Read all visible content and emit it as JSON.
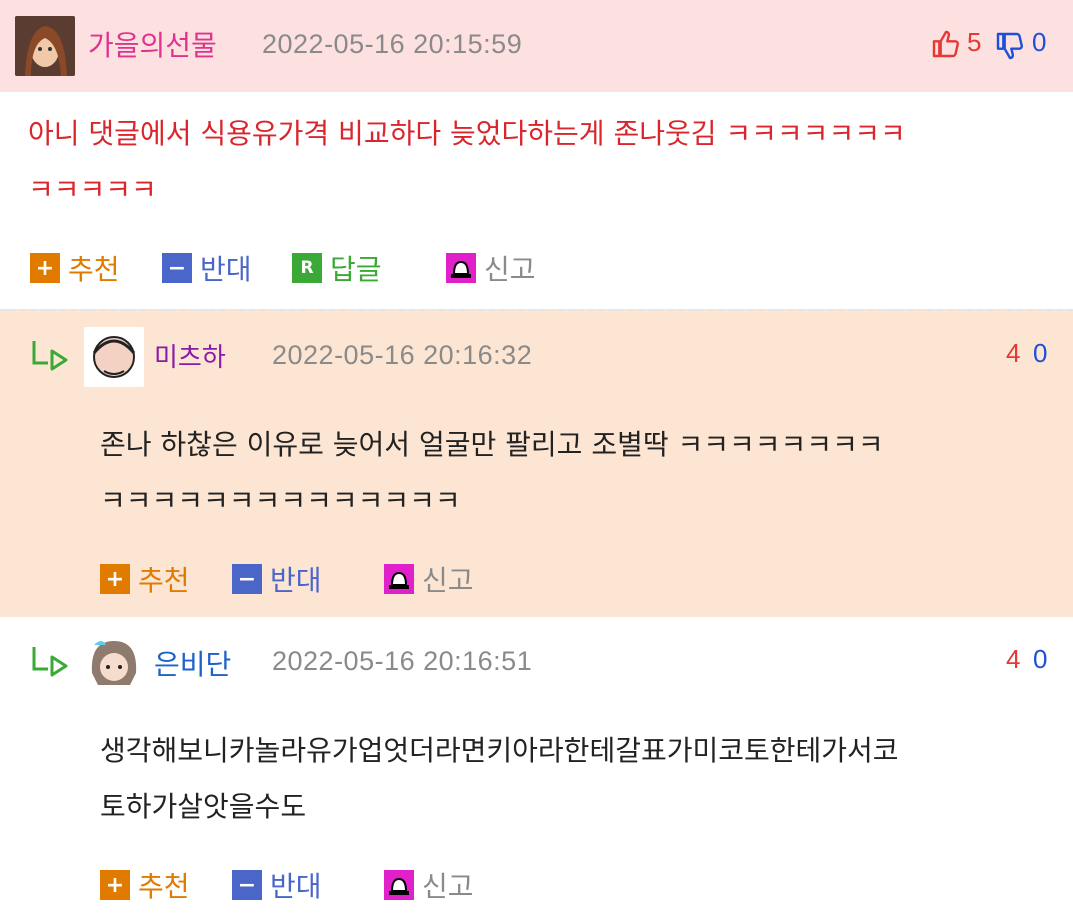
{
  "comments": [
    {
      "nickname": "가을의선물",
      "datetime": "2022-05-16 20:15:59",
      "text_line1": "아니 댓글에서 식용유가격 비교하다 늦었다하는게 존나웃김 ㅋㅋㅋㅋㅋㅋㅋ",
      "text_line2": "ㅋㅋㅋㅋㅋ",
      "up_votes": "5",
      "down_votes": "0",
      "actions": {
        "recommend": "추천",
        "oppose": "반대",
        "reply": "답글",
        "report": "신고",
        "reply_badge": "R"
      }
    },
    {
      "nickname": "미츠하",
      "datetime": "2022-05-16 20:16:32",
      "text_line1": "존나 하찮은 이유로 늦어서 얼굴만 팔리고 조별딱 ㅋㅋㅋㅋㅋㅋㅋㅋ",
      "text_line2": "ㅋㅋㅋㅋㅋㅋㅋㅋㅋㅋㅋㅋㅋㅋ",
      "up_votes": "4",
      "down_votes": "0",
      "actions": {
        "recommend": "추천",
        "oppose": "반대",
        "report": "신고"
      }
    },
    {
      "nickname": "은비단",
      "datetime": "2022-05-16 20:16:51",
      "text_line1": "생각해보니카놀라유가업엇더라면키아라한테갈표가미코토한테가서코",
      "text_line2": "토하가살앗을수도",
      "up_votes": "4",
      "down_votes": "0",
      "actions": {
        "recommend": "추천",
        "oppose": "반대",
        "report": "신고"
      }
    }
  ],
  "colors": {
    "header_pink": "#fde0e0",
    "reply_peach": "#fce6d3",
    "red_text": "#d9262c",
    "recommend_orange": "#e07b00",
    "oppose_blue": "#4a66c8",
    "reply_green": "#3aa935",
    "report_magenta": "#e020c8"
  },
  "icons": {
    "thumbs_up": "thumbs-up-icon",
    "thumbs_down": "thumbs-down-icon",
    "reply_arrow": "reply-arrow-icon",
    "plus": "plus-icon",
    "minus": "minus-icon",
    "siren": "siren-icon"
  }
}
